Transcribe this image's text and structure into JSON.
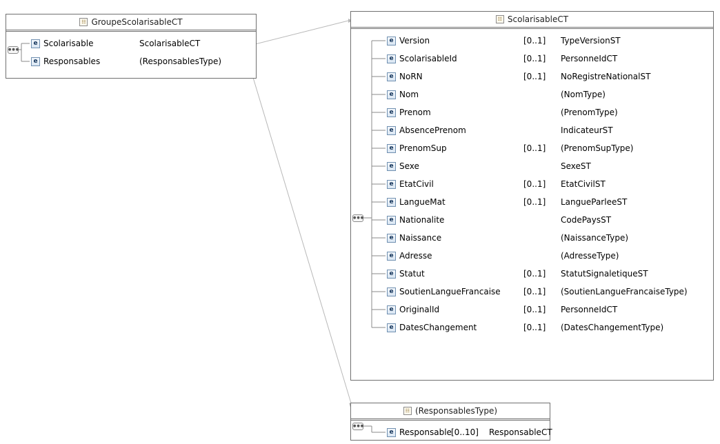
{
  "groupe": {
    "title": "GroupeScolarisableCT",
    "seq_icon": "sequence-compositor-icon",
    "rows": [
      {
        "name": "Scolarisable",
        "card": "",
        "type": "ScolarisableCT"
      },
      {
        "name": "Responsables",
        "card": "",
        "type": "(ResponsablesType)"
      }
    ]
  },
  "scolarisable": {
    "title": "ScolarisableCT",
    "seq_icon": "sequence-compositor-icon",
    "rows": [
      {
        "name": "Version",
        "card": "[0..1]",
        "type": "TypeVersionST"
      },
      {
        "name": "ScolarisableId",
        "card": "[0..1]",
        "type": "PersonneIdCT"
      },
      {
        "name": "NoRN",
        "card": "[0..1]",
        "type": "NoRegistreNationalST"
      },
      {
        "name": "Nom",
        "card": "",
        "type": "(NomType)"
      },
      {
        "name": "Prenom",
        "card": "",
        "type": "(PrenomType)"
      },
      {
        "name": "AbsencePrenom",
        "card": "",
        "type": "IndicateurST"
      },
      {
        "name": "PrenomSup",
        "card": "[0..1]",
        "type": "(PrenomSupType)"
      },
      {
        "name": "Sexe",
        "card": "",
        "type": "SexeST"
      },
      {
        "name": "EtatCivil",
        "card": "[0..1]",
        "type": "EtatCivilST"
      },
      {
        "name": "LangueMat",
        "card": "[0..1]",
        "type": "LangueParleeST"
      },
      {
        "name": "Nationalite",
        "card": "",
        "type": "CodePaysST"
      },
      {
        "name": "Naissance",
        "card": "",
        "type": "(NaissanceType)"
      },
      {
        "name": "Adresse",
        "card": "",
        "type": "(AdresseType)"
      },
      {
        "name": "Statut",
        "card": "[0..1]",
        "type": "StatutSignaletiqueST"
      },
      {
        "name": "SoutienLangueFrancaise",
        "card": "[0..1]",
        "type": "(SoutienLangueFrancaiseType)"
      },
      {
        "name": "OriginalId",
        "card": "[0..1]",
        "type": "PersonneIdCT"
      },
      {
        "name": "DatesChangement",
        "card": "[0..1]",
        "type": "(DatesChangementType)"
      }
    ]
  },
  "responsables": {
    "title": "(ResponsablesType)",
    "seq_icon": "sequence-compositor-icon",
    "rows": [
      {
        "name": "Responsable",
        "card": "[0..10]",
        "type": "ResponsableCT"
      }
    ]
  },
  "icons": {
    "element": "e",
    "complex_type": "complex-type-icon"
  },
  "colors": {
    "border": "#6f6f6f",
    "connector": "#b8b8b8",
    "element_icon": "#16365c"
  }
}
